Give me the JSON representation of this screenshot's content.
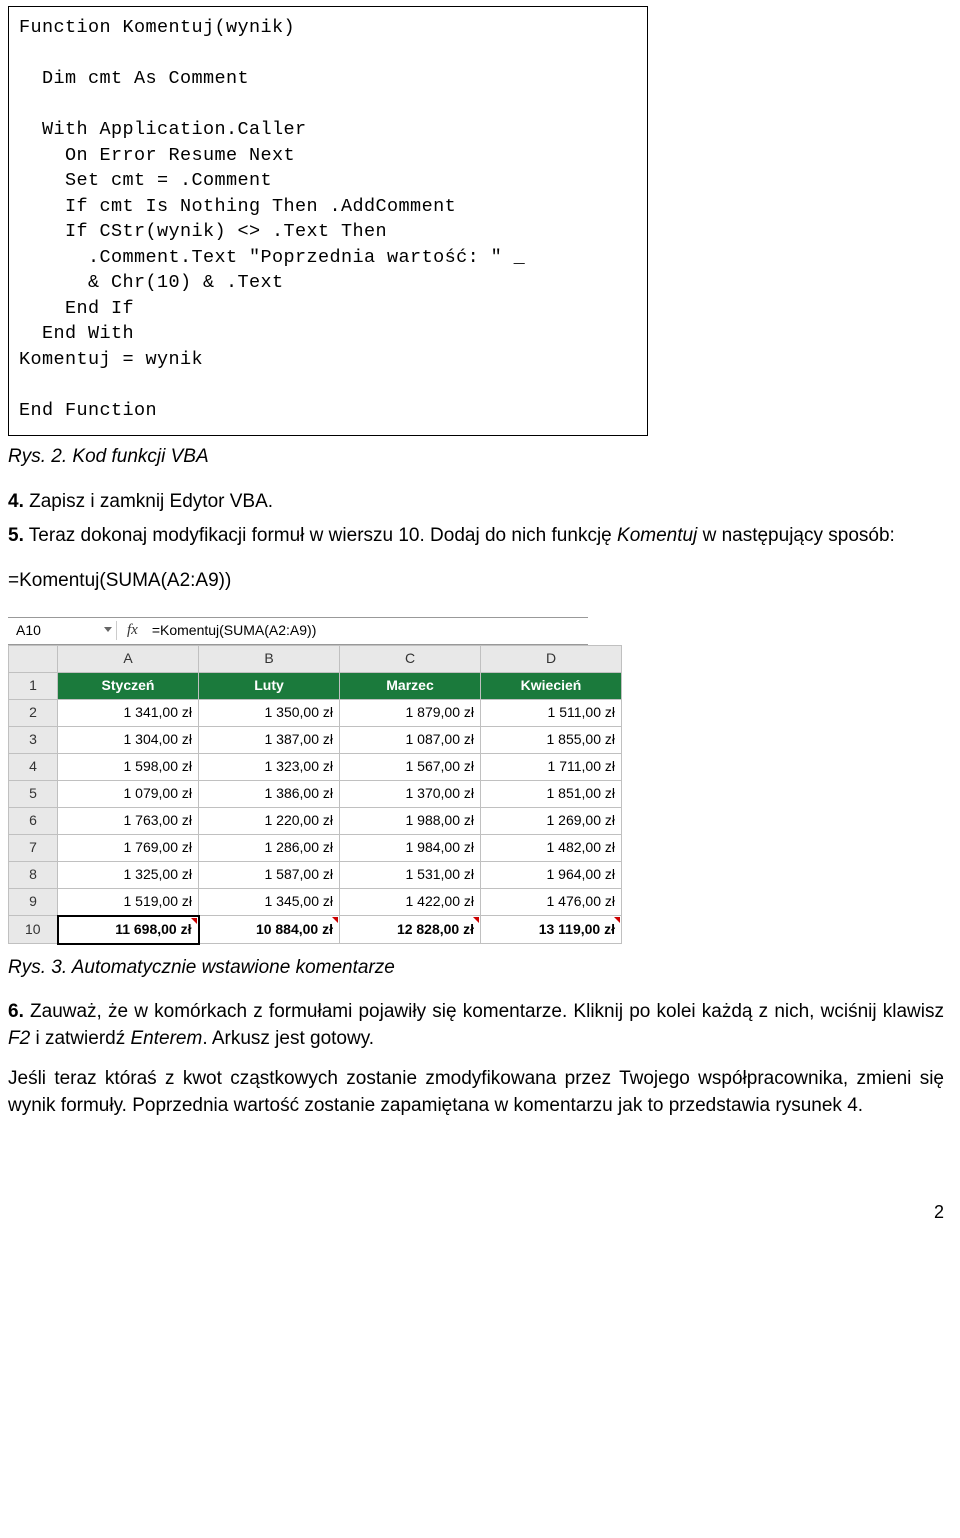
{
  "code": "Function Komentuj(wynik)\n\n  Dim cmt As Comment\n\n  With Application.Caller\n    On Error Resume Next\n    Set cmt = .Comment\n    If cmt Is Nothing Then .AddComment\n    If CStr(wynik) <> .Text Then\n      .Comment.Text \"Poprzednia wartość: \" _\n      & Chr(10) & .Text\n    End If\n  End With\nKomentuj = wynik\n\nEnd Function",
  "caption1": "Rys. 2. Kod funkcji VBA",
  "step4": {
    "num": "4.",
    "text": " Zapisz i zamknij Edytor VBA."
  },
  "step5": {
    "num": "5.",
    "before": " Teraz dokonaj modyfikacji formuł w wierszu 10. Dodaj do nich funkcję ",
    "italic": "Komentuj",
    "after": " w następujący sposób:"
  },
  "formula": "=Komentuj(SUMA(A2:A9))",
  "formula_bar_cell": "A10",
  "formula_bar_fx": "fx",
  "formula_bar_value": "=Komentuj(SUMA(A2:A9))",
  "chart_data": {
    "type": "table",
    "columns": [
      "A",
      "B",
      "C",
      "D"
    ],
    "header_row": [
      "Styczeń",
      "Luty",
      "Marzec",
      "Kwiecień"
    ],
    "rows": [
      [
        "1 341,00 zł",
        "1 350,00 zł",
        "1 879,00 zł",
        "1 511,00 zł"
      ],
      [
        "1 304,00 zł",
        "1 387,00 zł",
        "1 087,00 zł",
        "1 855,00 zł"
      ],
      [
        "1 598,00 zł",
        "1 323,00 zł",
        "1 567,00 zł",
        "1 711,00 zł"
      ],
      [
        "1 079,00 zł",
        "1 386,00 zł",
        "1 370,00 zł",
        "1 851,00 zł"
      ],
      [
        "1 763,00 zł",
        "1 220,00 zł",
        "1 988,00 zł",
        "1 269,00 zł"
      ],
      [
        "1 769,00 zł",
        "1 286,00 zł",
        "1 984,00 zł",
        "1 482,00 zł"
      ],
      [
        "1 325,00 zł",
        "1 587,00 zł",
        "1 531,00 zł",
        "1 964,00 zł"
      ],
      [
        "1 519,00 zł",
        "1 345,00 zł",
        "1 422,00 zł",
        "1 476,00 zł"
      ]
    ],
    "sum_row": [
      "11 698,00 zł",
      "10 884,00 zł",
      "12 828,00 zł",
      "13 119,00 zł"
    ]
  },
  "row_labels": [
    "1",
    "2",
    "3",
    "4",
    "5",
    "6",
    "7",
    "8",
    "9",
    "10"
  ],
  "caption3": "Rys. 3. Automatycznie wstawione komentarze",
  "step6": {
    "num": "6.",
    "part1": " Zauważ, że w komórkach z formułami pojawiły się komentarze. Kliknij po kolei każdą z nich, wciśnij klawisz ",
    "key": "F2",
    "part2": " i zatwierdź ",
    "key2": "Enterem",
    "part3": ". Arkusz jest gotowy."
  },
  "closing": "Jeśli teraz któraś z kwot cząstkowych zostanie zmodyfikowana przez Twojego współpracownika, zmieni się wynik formuły. Poprzednia wartość zostanie zapamiętana w komentarzu jak to przedstawia rysunek 4.",
  "page_num": "2"
}
